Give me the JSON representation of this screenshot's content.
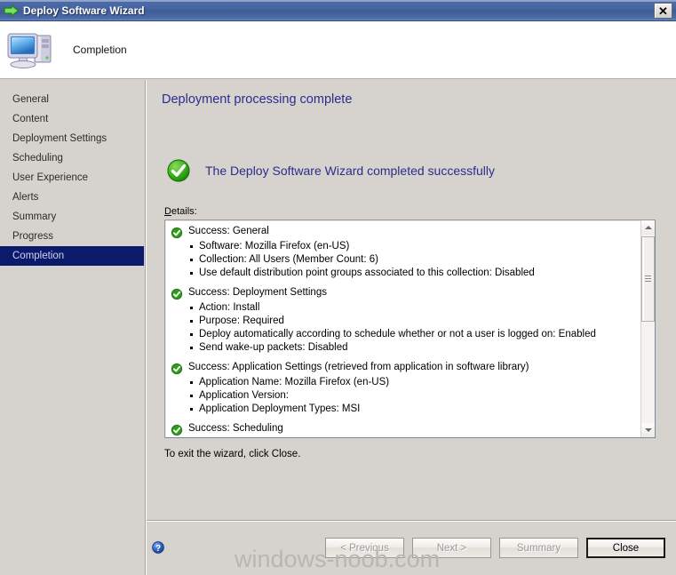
{
  "window": {
    "title": "Deploy Software Wizard",
    "title_icon": "green-arrow-icon",
    "close_label": "✕",
    "titlebar_color": "#46649f"
  },
  "header": {
    "icon": "computer-icon",
    "step_title": "Completion"
  },
  "sidebar": {
    "items": [
      {
        "label": "General",
        "selected": false
      },
      {
        "label": "Content",
        "selected": false
      },
      {
        "label": "Deployment Settings",
        "selected": false
      },
      {
        "label": "Scheduling",
        "selected": false
      },
      {
        "label": "User Experience",
        "selected": false
      },
      {
        "label": "Alerts",
        "selected": false
      },
      {
        "label": "Summary",
        "selected": false
      },
      {
        "label": "Progress",
        "selected": false
      },
      {
        "label": "Completion",
        "selected": true
      }
    ],
    "selected_color": "#0c1a6b"
  },
  "main": {
    "heading": "Deployment processing complete",
    "heading_color": "#2c2c8c",
    "success_icon": "green-check-circle-icon",
    "success_message": "The Deploy Software Wizard completed successfully",
    "details_label_accesskey": "D",
    "details_label_rest": "etails:",
    "exit_note": "To exit the wizard, click Close.",
    "details": [
      {
        "icon": "green-check-icon",
        "heading": "Success: General",
        "bullets": [
          "Software: Mozilla Firefox (en-US)",
          "Collection: All Users (Member Count: 6)",
          "Use default distribution point groups associated to this collection: Disabled"
        ]
      },
      {
        "icon": "green-check-icon",
        "heading": "Success: Deployment Settings",
        "bullets": [
          "Action: Install",
          "Purpose: Required",
          "Deploy automatically according to schedule whether or not a user is logged on: Enabled",
          "Send wake-up packets: Disabled"
        ]
      },
      {
        "icon": "green-check-icon",
        "heading": "Success: Application Settings (retrieved from application in software library)",
        "bullets": [
          "Application Name: Mozilla Firefox (en-US)",
          "Application Version:",
          "Application Deployment Types: MSI"
        ]
      },
      {
        "icon": "green-check-icon",
        "heading": "Success: Scheduling",
        "bullets": []
      }
    ]
  },
  "footer": {
    "help_icon": "help-question-icon",
    "buttons": [
      {
        "label": "< Previous",
        "accesskey": "P",
        "state": "disabled"
      },
      {
        "label": "Next >",
        "accesskey": "N",
        "state": "disabled"
      },
      {
        "label": "Summary",
        "accesskey": "S",
        "state": "disabled"
      },
      {
        "label": "Close",
        "accesskey": "",
        "state": "default"
      }
    ]
  },
  "watermark": "windows-noob.com"
}
